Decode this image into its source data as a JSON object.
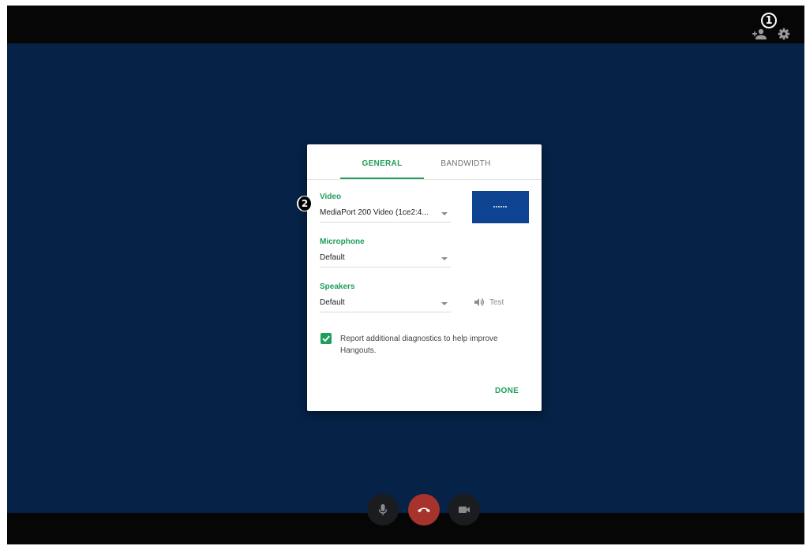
{
  "annotations": {
    "one": "1",
    "two": "2"
  },
  "toolbar": {
    "icons": [
      "add-person-icon",
      "gear-icon"
    ]
  },
  "settings_dialog": {
    "tabs": [
      {
        "label": "GENERAL",
        "active": true
      },
      {
        "label": "BANDWIDTH",
        "active": false
      }
    ],
    "video": {
      "label": "Video",
      "value": "MediaPort 200 Video (1ce2:4..."
    },
    "microphone": {
      "label": "Microphone",
      "value": "Default"
    },
    "speakers": {
      "label": "Speakers",
      "value": "Default"
    },
    "test_label": "Test",
    "diagnostics": {
      "checked": true,
      "text": "Report additional diagnostics to help improve Hangouts."
    },
    "done_label": "DONE"
  },
  "call_controls": {
    "icons": [
      "microphone-icon",
      "end-call-icon",
      "video-camera-icon"
    ]
  },
  "colors": {
    "accent": "#1e9e5a",
    "background": "#062246",
    "bars": "#060606",
    "end_call": "#a7332d"
  }
}
